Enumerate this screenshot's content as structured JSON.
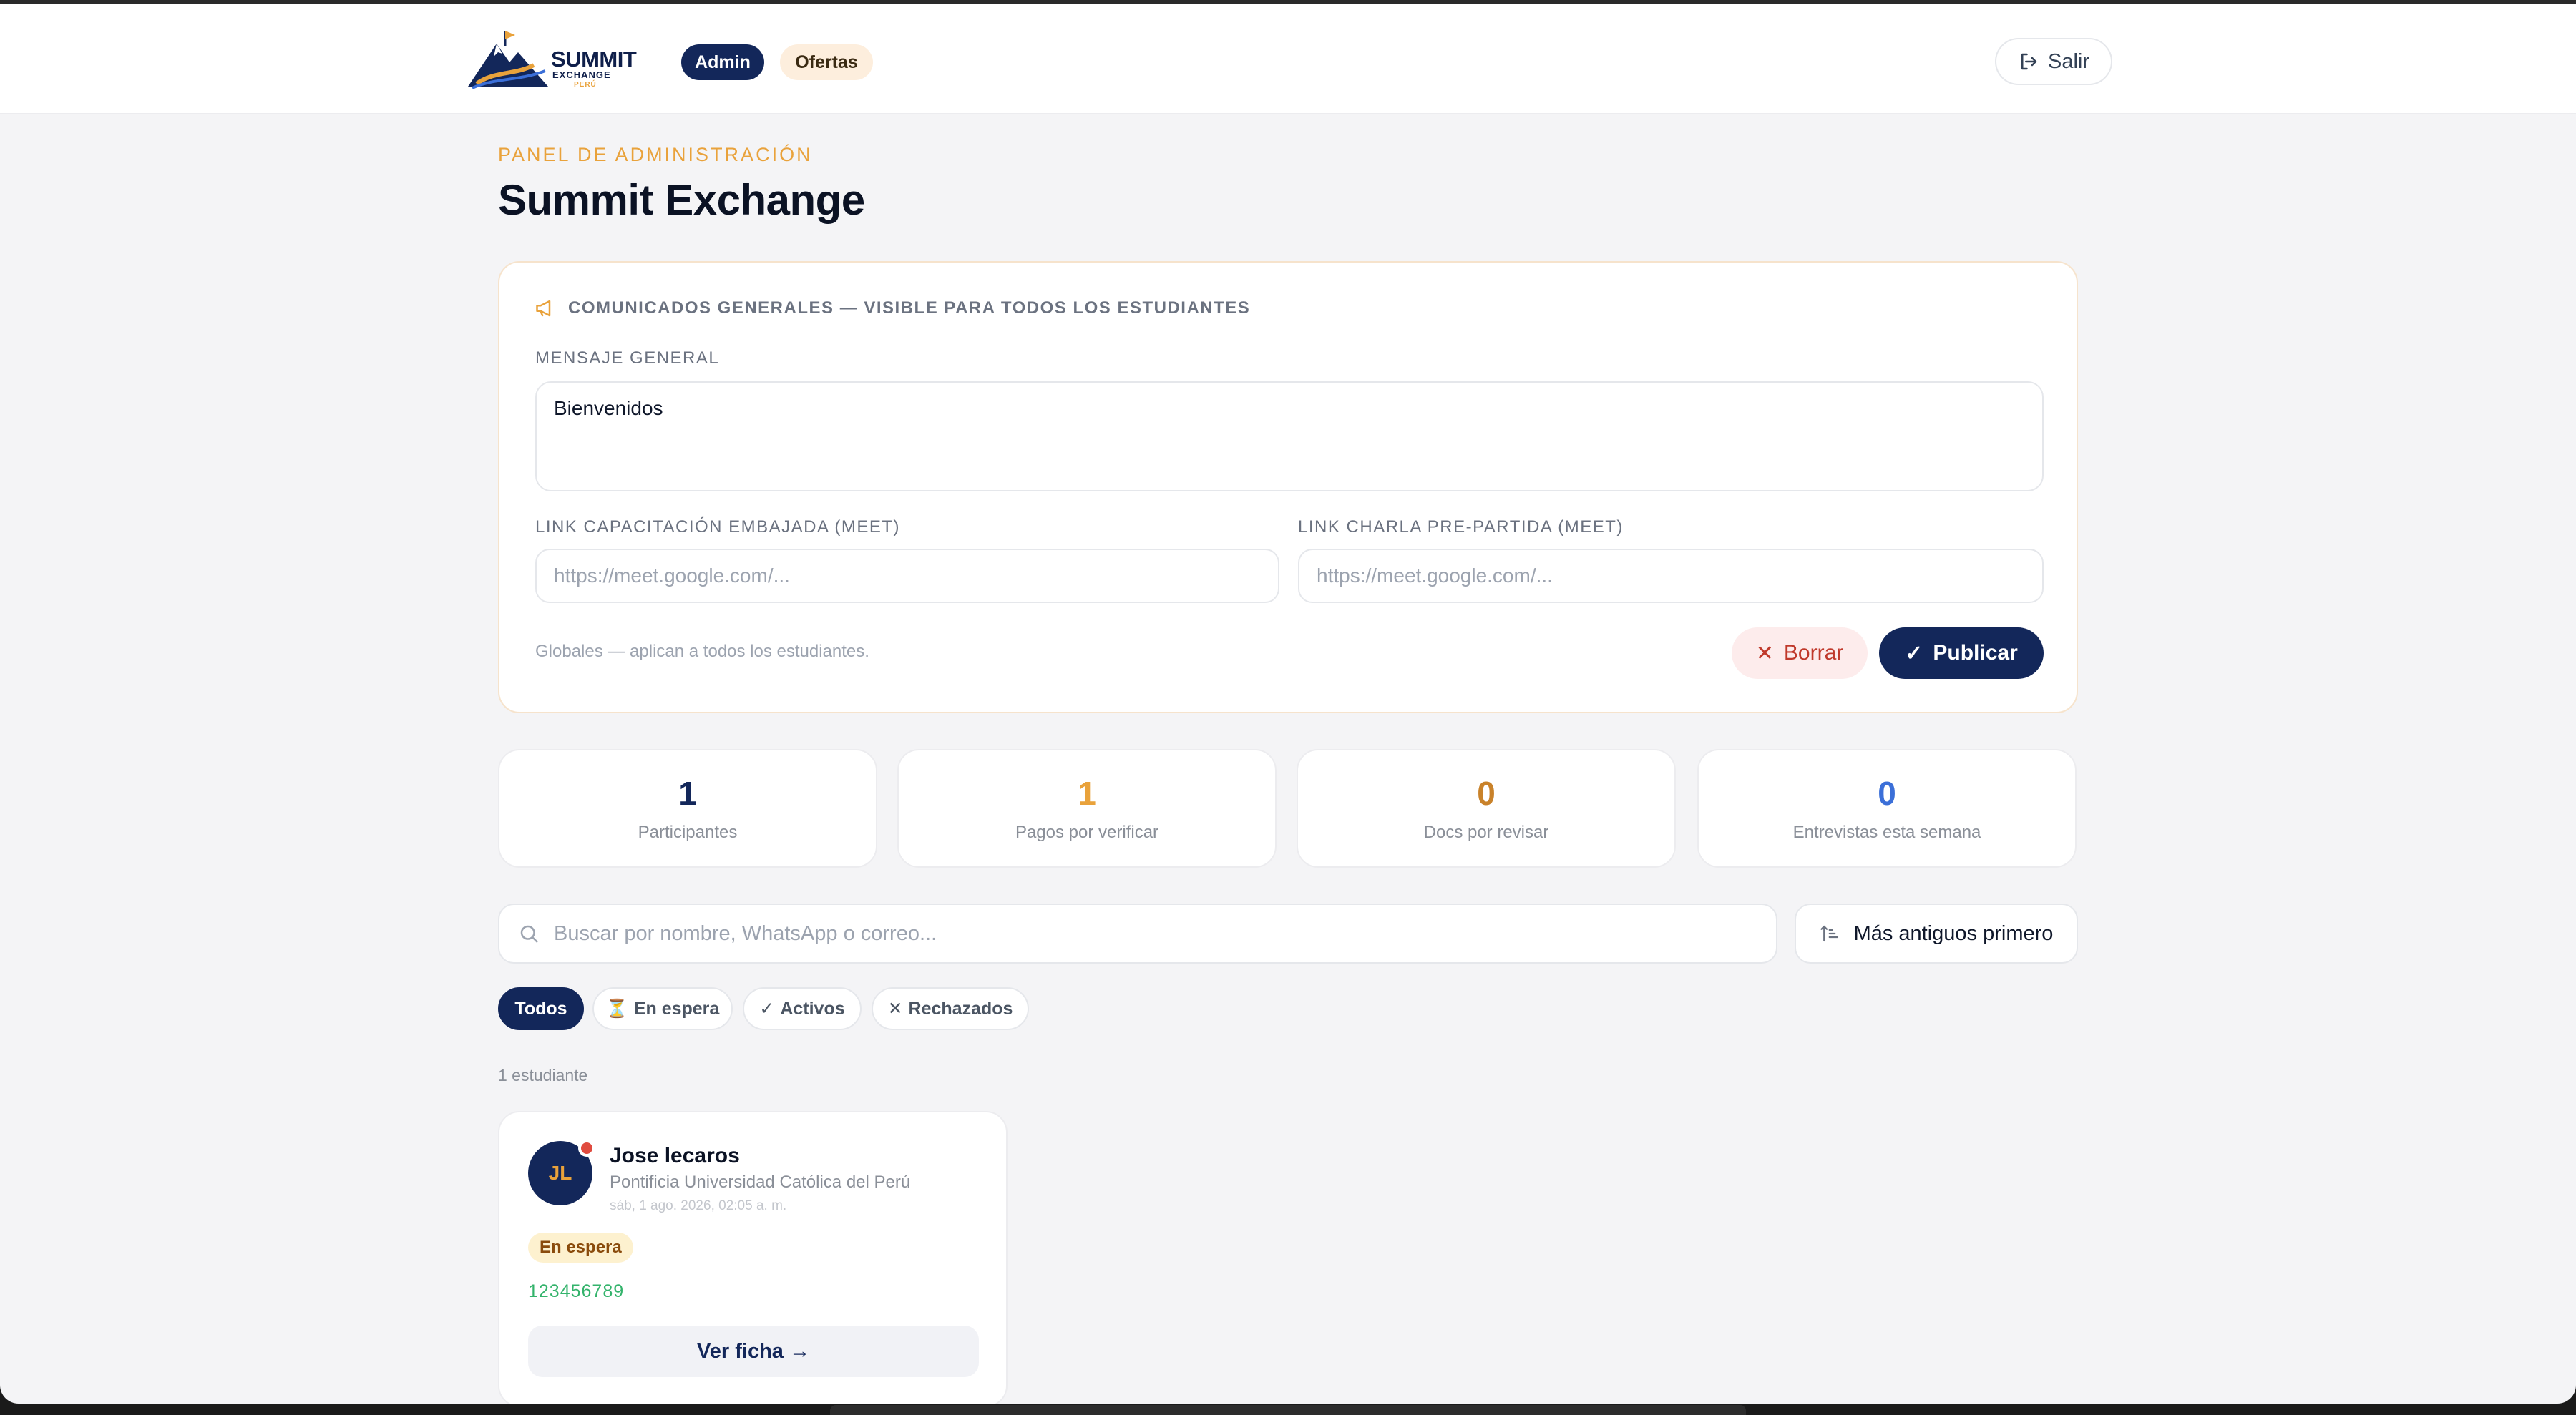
{
  "header": {
    "logo": {
      "title": "SUMMIT",
      "subtitle": "EXCHANGE",
      "region": "PERÚ"
    },
    "nav": [
      {
        "label": "Admin",
        "active": true
      },
      {
        "label": "Ofertas",
        "active": false
      }
    ],
    "logout_label": "Salir"
  },
  "page": {
    "kicker": "PANEL DE ADMINISTRACIÓN",
    "title": "Summit Exchange"
  },
  "announcements": {
    "heading": "COMUNICADOS GENERALES — VISIBLE PARA TODOS LOS ESTUDIANTES",
    "message_label": "MENSAJE GENERAL",
    "message_value": "Bienvenidos",
    "embassy_label": "LINK CAPACITACIÓN EMBAJADA (MEET)",
    "embassy_placeholder": "https://meet.google.com/...",
    "predeparture_label": "LINK CHARLA PRE-PARTIDA (MEET)",
    "predeparture_placeholder": "https://meet.google.com/...",
    "footnote": "Globales — aplican a todos los estudiantes.",
    "clear_label": "Borrar",
    "publish_label": "Publicar"
  },
  "stats": [
    {
      "value": "1",
      "label": "Participantes",
      "color": "#13275a"
    },
    {
      "value": "1",
      "label": "Pagos por verificar",
      "color": "#e9a23b"
    },
    {
      "value": "0",
      "label": "Docs por revisar",
      "color": "#c9822a"
    },
    {
      "value": "0",
      "label": "Entrevistas esta semana",
      "color": "#3b6fd8"
    }
  ],
  "search": {
    "placeholder": "Buscar por nombre, WhatsApp o correo...",
    "sort_label": "Más antiguos primero"
  },
  "filters": [
    {
      "label": "Todos",
      "icon": "",
      "active": true
    },
    {
      "label": "En espera",
      "icon": "⏳",
      "active": false
    },
    {
      "label": "Activos",
      "icon": "✓",
      "active": false
    },
    {
      "label": "Rechazados",
      "icon": "✕",
      "active": false
    }
  ],
  "results_count": "1 estudiante",
  "students": [
    {
      "initials": "JL",
      "name": "Jose lecaros",
      "university": "Pontificia Universidad Católica del Perú",
      "date": "sáb, 1 ago. 2026, 02:05 a. m.",
      "status": "En espera",
      "phone": "123456789",
      "action_label": "Ver ficha →"
    }
  ]
}
